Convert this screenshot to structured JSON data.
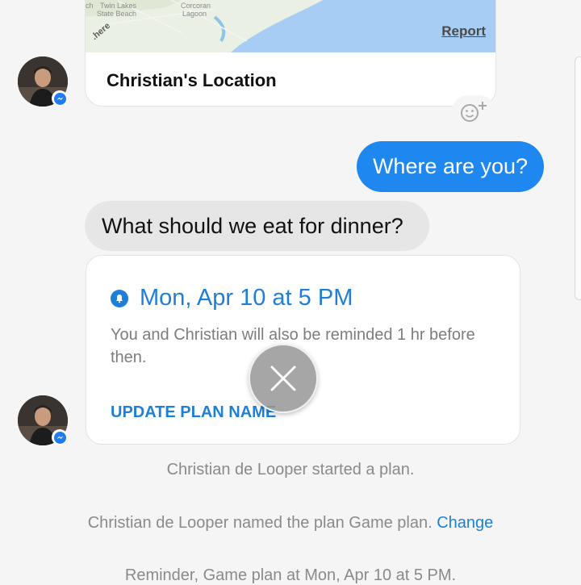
{
  "map": {
    "labels": [
      "ch",
      "Twin Lakes",
      "State Beach",
      "Corcoran",
      "Lagoon"
    ],
    "report_label": "Report",
    "provider_logo": ".here",
    "title": "Christian's Location"
  },
  "reaction": {
    "icon": "smiley-plus-icon"
  },
  "messages": {
    "outgoing": "Where are you?",
    "incoming": "What should we eat for dinner?"
  },
  "plan": {
    "date": "Mon, Apr 10 at 5 PM",
    "description": "You and Christian will also be reminded 1 hr before then.",
    "update_label": "UPDATE PLAN NAME"
  },
  "system": {
    "started": "Christian de Looper started a plan.",
    "named": "Christian de Looper named the plan Game plan.",
    "change_label": "Change",
    "reminder": "Reminder, Game plan at Mon, Apr 10 at 5 PM."
  },
  "colors": {
    "accent": "#1e88f0",
    "link": "#1e7fd8",
    "incoming_bubble": "#e6e6e6"
  }
}
